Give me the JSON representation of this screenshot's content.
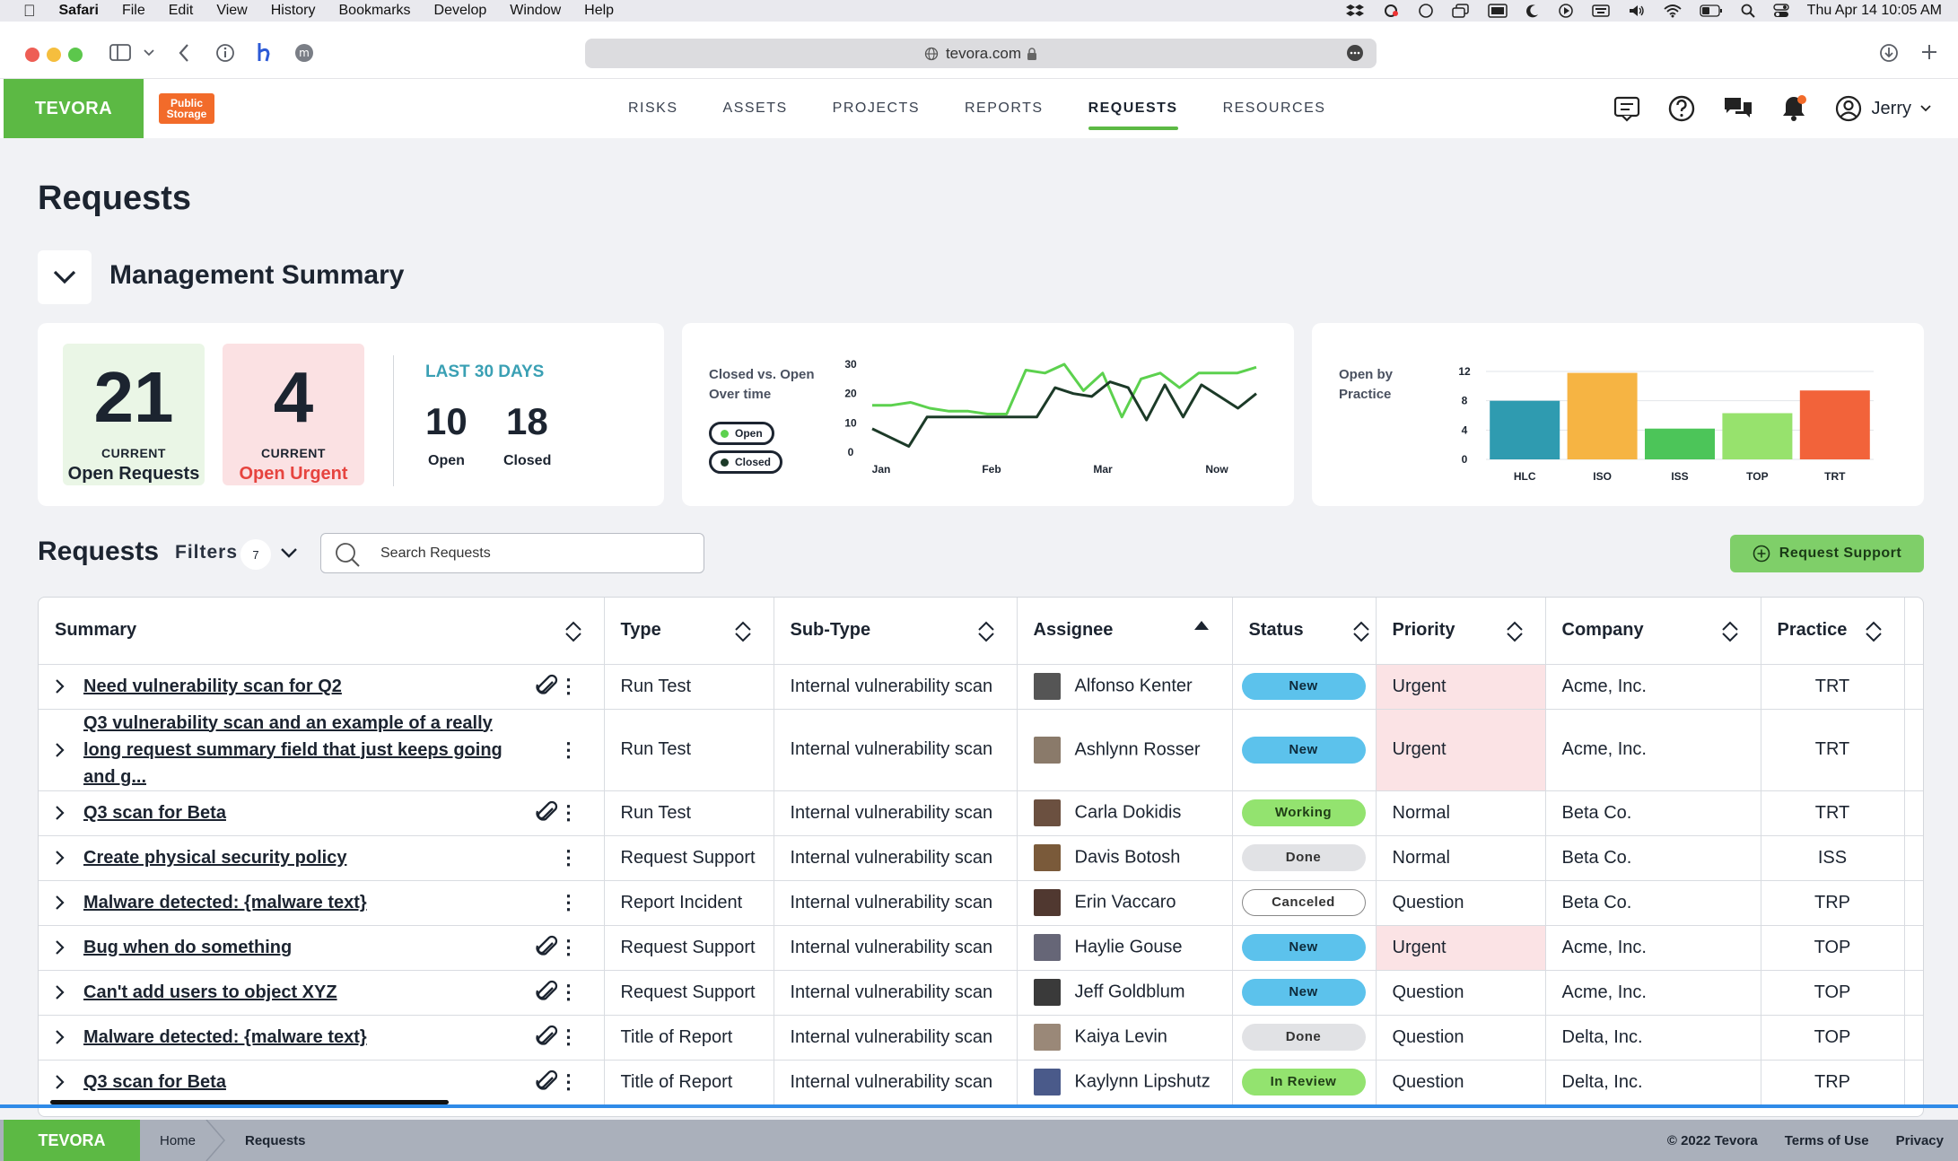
{
  "menubar": {
    "apple": "",
    "app": "Safari",
    "items": [
      "File",
      "Edit",
      "View",
      "History",
      "Bookmarks",
      "Develop",
      "Window",
      "Help"
    ],
    "datetime": "Thu Apr 14  10:05 AM"
  },
  "browser": {
    "url": "tevora.com"
  },
  "app": {
    "logo": "TEVORA",
    "client_logo_line1": "Public",
    "client_logo_line2": "Storage",
    "nav": [
      "RISKS",
      "ASSETS",
      "PROJECTS",
      "REPORTS",
      "REQUESTS",
      "RESOURCES"
    ],
    "active_nav": "REQUESTS",
    "user": "Jerry"
  },
  "page": {
    "title": "Requests",
    "summary_title": "Management Summary"
  },
  "kpis": {
    "open_requests": {
      "value": "21",
      "small": "CURRENT",
      "label": "Open Requests"
    },
    "open_urgent": {
      "value": "4",
      "small": "CURRENT",
      "label": "Open Urgent"
    },
    "last30": "LAST 30 DAYS",
    "open": {
      "value": "10",
      "label": "Open"
    },
    "closed": {
      "value": "18",
      "label": "Closed"
    }
  },
  "chart_data": [
    {
      "type": "line",
      "title": "Closed vs. Open Over time",
      "x": [
        "Jan",
        "Feb",
        "Mar",
        "Now"
      ],
      "ylim": [
        0,
        30
      ],
      "yticks": [
        0,
        10,
        20,
        30
      ],
      "legend": [
        "Open",
        "Closed"
      ],
      "series": [
        {
          "name": "Open",
          "color": "#5cd14e",
          "values": [
            16,
            16,
            17,
            15,
            14,
            14,
            13,
            13,
            28,
            27,
            30,
            21,
            27,
            12,
            25,
            27,
            22,
            27,
            27,
            27,
            29
          ]
        },
        {
          "name": "Closed",
          "color": "#1c3a28",
          "values": [
            8,
            5,
            2,
            12,
            12,
            12,
            12,
            12,
            12,
            12,
            22,
            20,
            19,
            24,
            22,
            11,
            23,
            12,
            23,
            19,
            15,
            20
          ]
        }
      ]
    },
    {
      "type": "bar",
      "title": "Open by Practice",
      "categories": [
        "HLC",
        "ISO",
        "ISS",
        "TOP",
        "TRT"
      ],
      "values": [
        8,
        11.8,
        4.2,
        6.3,
        9.4
      ],
      "colors": [
        "#2f9bb0",
        "#f6b443",
        "#4cc559",
        "#97e26d",
        "#f2633a"
      ],
      "ylim": [
        0,
        12
      ],
      "yticks": [
        0,
        4,
        8,
        12
      ]
    }
  ],
  "requests": {
    "title": "Requests",
    "filters_label": "Filters",
    "filters_count": "7",
    "search_placeholder": "Search Requests",
    "support_button": "Request Support",
    "columns": [
      "Summary",
      "Type",
      "Sub-Type",
      "Assignee",
      "Status",
      "Priority",
      "Company",
      "Practice"
    ],
    "rows": [
      {
        "summary": "Need vulnerability scan for Q2",
        "clip": true,
        "type": "Run Test",
        "subtype": "Internal vulnerability scan",
        "assignee": "Alfonso Kenter",
        "status": "New",
        "priority": "Urgent",
        "company": "Acme, Inc.",
        "practice": "TRT"
      },
      {
        "summary": "Q3 vulnerability scan and an example of a really long request summary field that just keeps going and g...",
        "clip": false,
        "type": "Run Test",
        "subtype": "Internal vulnerability scan",
        "assignee": "Ashlynn Rosser",
        "status": "New",
        "priority": "Urgent",
        "company": "Acme, Inc.",
        "practice": "TRT"
      },
      {
        "summary": "Q3 scan for Beta",
        "clip": true,
        "type": "Run Test",
        "subtype": "Internal vulnerability scan",
        "assignee": "Carla Dokidis",
        "status": "Working",
        "priority": "Normal",
        "company": "Beta Co.",
        "practice": "TRT"
      },
      {
        "summary": "Create physical security policy",
        "clip": false,
        "type": "Request Support",
        "subtype": "Internal vulnerability scan",
        "assignee": "Davis Botosh",
        "status": "Done",
        "priority": "Normal",
        "company": "Beta Co.",
        "practice": "ISS"
      },
      {
        "summary": "Malware detected: {malware text}",
        "clip": false,
        "type": "Report Incident",
        "subtype": "Internal vulnerability scan",
        "assignee": "Erin Vaccaro",
        "status": "Canceled",
        "priority": "Question",
        "company": "Beta Co.",
        "practice": "TRP"
      },
      {
        "summary": "Bug when do something",
        "clip": true,
        "type": "Request Support",
        "subtype": "Internal vulnerability scan",
        "assignee": "Haylie Gouse",
        "status": "New",
        "priority": "Urgent",
        "company": "Acme, Inc.",
        "practice": "TOP"
      },
      {
        "summary": "Can't add users to object XYZ",
        "clip": true,
        "type": "Request Support",
        "subtype": "Internal vulnerability scan",
        "assignee": "Jeff Goldblum",
        "status": "New",
        "priority": "Question",
        "company": "Acme, Inc.",
        "practice": "TOP"
      },
      {
        "summary": "Malware detected: {malware text}",
        "clip": true,
        "type": "Title of Report",
        "subtype": "Internal vulnerability scan",
        "assignee": "Kaiya Levin",
        "status": "Done",
        "priority": "Question",
        "company": "Delta, Inc.",
        "practice": "TOP"
      },
      {
        "summary": "Q3 scan for Beta",
        "clip": true,
        "type": "Title of Report",
        "subtype": "Internal vulnerability scan",
        "assignee": "Kaylynn Lipshutz",
        "status": "In Review",
        "priority": "Question",
        "company": "Delta, Inc.",
        "practice": "TRP"
      }
    ]
  },
  "footer": {
    "logo": "TEVORA",
    "crumbs": [
      "Home",
      "Requests"
    ],
    "copyright": "© 2022 Tevora",
    "terms": "Terms of Use",
    "privacy": "Privacy"
  }
}
